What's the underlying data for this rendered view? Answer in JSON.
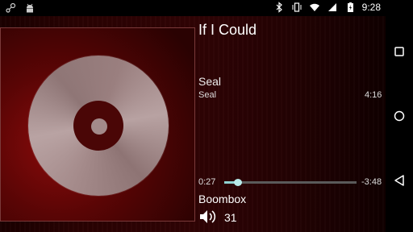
{
  "status_bar": {
    "time": "9:28",
    "left_icons": [
      "steam-icon",
      "android-icon"
    ],
    "right_icons": [
      "bluetooth-icon",
      "vibrate-icon",
      "wifi-icon",
      "signal-icon",
      "battery-charging-icon"
    ]
  },
  "track": {
    "title": "If I Could",
    "artist": "Seal",
    "album": "Seal",
    "duration": "4:16",
    "elapsed": "0:27",
    "remaining": "-3:48",
    "progress_fraction": 0.105
  },
  "output": {
    "device": "Boombox",
    "volume": "31"
  },
  "nav": [
    "recents-square-icon",
    "home-circle-icon",
    "back-triangle-icon"
  ],
  "colors": {
    "accent": "#8fd3d3",
    "background": "#300304"
  }
}
